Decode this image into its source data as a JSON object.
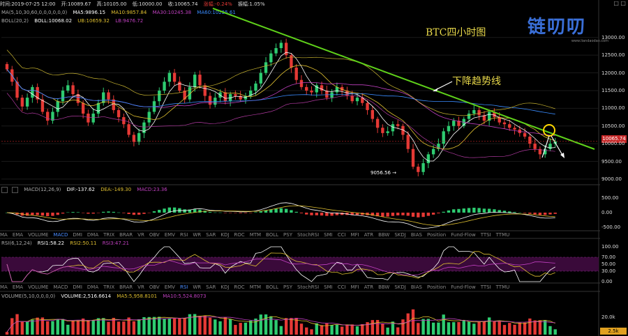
{
  "infobar": {
    "time": "时间:2019-07-25 12:00",
    "open": "开:10089.67",
    "high": "高:10105.00",
    "low": "低:10000.00",
    "close": "收:10065.74",
    "change": "涨幅:-0.24%",
    "amplitude": "振幅:1.05%"
  },
  "window_buttons": "□ □",
  "main_legend": {
    "ma_params": "MA(5,10,30,60,0,0,0,0,0,0)",
    "ma5": "MA5:9896.15",
    "ma10": "MA10:9857.84",
    "ma30": "MA30:10245.38",
    "ma60": "MA60:10225.61"
  },
  "boll_legend": {
    "params": "BOLL(20,2)",
    "boll": "BOLL:10068.02",
    "ub": "UB:10659.32",
    "lb": "LB:9476.72"
  },
  "annotations": {
    "chart_title": "BTC四小时图",
    "trend_label": "下降趋势线",
    "low_label": "9056.56 →",
    "current_price": "10065.74"
  },
  "logo": {
    "text": "链叨叨",
    "url": "www.liandaodao.com"
  },
  "macd_legend": {
    "params": "MACD(12,26,9)",
    "dif": "DIF:-137.62",
    "dea": "DEA:-149.30",
    "macd": "MACD:23.36"
  },
  "rsi_legend": {
    "params": "RSI(6,12,24)",
    "rsi1": "RSI1:58.22",
    "rsi2": "RSI2:50.11",
    "rsi3": "RSI3:47.21"
  },
  "volume_legend": {
    "params": "VOLUME(5,10,0,0,0,0)",
    "volume": "VOLUME:2,516.6614",
    "ma5": "MA5:5,958.8101",
    "ma10": "MA10:5,524.8073"
  },
  "indicator_tabs": [
    "MA",
    "EMA",
    "VOLUME",
    "MACD",
    "DMI",
    "DMA",
    "TRIX",
    "BRAR",
    "VR",
    "OBV",
    "EMV",
    "RSI",
    "WR",
    "SAR",
    "KDJ",
    "ROC",
    "MTM",
    "BOLL",
    "PSY",
    "StochRSI",
    "SMI",
    "CCI",
    "MFI",
    "ATR",
    "BBW",
    "SKDJ",
    "BIAS",
    "Position",
    "Fund-Flow",
    "TTSI",
    "TTMU"
  ],
  "active_tab_row1": "MACD",
  "active_tab_row2": "RSI",
  "vol_tag": "2.5k",
  "colors": {
    "up": "#2ecc71",
    "down": "#e53935",
    "trendline": "#5fd11a",
    "title": "#e8d84a",
    "ma_white": "#ffffff",
    "ma_yellow": "#e0c030",
    "ma_purple": "#c040c0",
    "ma_blue": "#3a8cff"
  },
  "chart_data": {
    "type": "candlestick",
    "symbol": "BTC",
    "timeframe": "4H",
    "price_axis": {
      "ticks": [
        9000,
        9500,
        10000,
        10500,
        11000,
        11500,
        12000,
        12500,
        13000
      ],
      "ylim": [
        8900,
        13350
      ]
    },
    "macd_axis": {
      "ticks": [
        500,
        0,
        -500
      ],
      "ylim": [
        -600,
        650
      ]
    },
    "rsi_axis": {
      "ticks": [
        100,
        70,
        50,
        30,
        0
      ],
      "ylim": [
        0,
        100
      ]
    },
    "volume_axis": {
      "ticks": [
        20000
      ],
      "ylim": [
        0,
        40000
      ]
    },
    "close_prices": [
      12100,
      11750,
      11300,
      11050,
      11300,
      11600,
      11250,
      10900,
      10650,
      10900,
      11200,
      11500,
      11650,
      11400,
      11150,
      10850,
      10600,
      10850,
      11150,
      11450,
      11250,
      10950,
      10750,
      10550,
      10250,
      10050,
      10300,
      10600,
      10900,
      11200,
      11500,
      11750,
      12000,
      11750,
      11500,
      11250,
      11600,
      11950,
      11650,
      11350,
      11100,
      11300,
      11450,
      11200,
      11400,
      11350,
      11250,
      11350,
      11500,
      11700,
      12000,
      12300,
      12550,
      12700,
      12850,
      12500,
      12150,
      11800,
      11600,
      11500,
      11450,
      11650,
      11500,
      11300,
      11450,
      11600,
      11500,
      11350,
      11200,
      11300,
      11150,
      10950,
      10700,
      10450,
      10300,
      10350,
      10550,
      10500,
      10250,
      9850,
      9350,
      9200,
      9450,
      9700,
      9850,
      10000,
      10350,
      10500,
      10650,
      10500,
      10700,
      10850,
      10950,
      10800,
      10650,
      10900,
      10750,
      10600,
      10550,
      10450,
      10400,
      10300,
      10200,
      10000,
      9850,
      9700,
      9850,
      10000,
      10065.74
    ],
    "boll": {
      "middle": 10068.02,
      "upper": 10659.32,
      "lower": 9476.72
    },
    "low_point": {
      "value": 9056.56
    },
    "trendline": {
      "from_close_index": 43,
      "from_price": 12900,
      "slope_per_bar": -36.6
    },
    "macd": {
      "dif": -137.62,
      "dea": -149.3,
      "hist": 23.36
    },
    "rsi": {
      "rsi1": 58.22,
      "rsi2": 50.11,
      "rsi3": 47.21
    },
    "volume": {
      "last": 2516.6614,
      "ma5": 5958.8101,
      "ma10": 5524.8073
    }
  }
}
